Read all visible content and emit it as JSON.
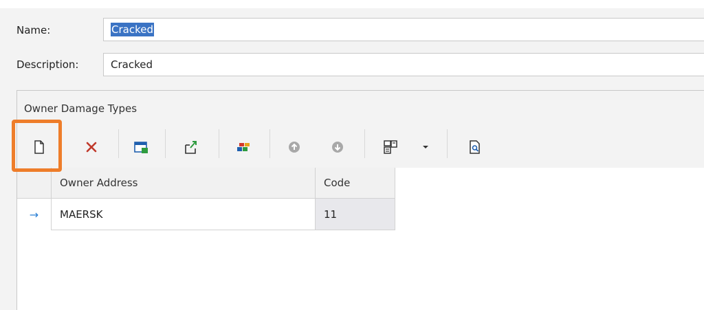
{
  "form": {
    "name_label": "Name:",
    "name_value": "Cracked",
    "description_label": "Description:",
    "description_value": "Cracked"
  },
  "panel": {
    "title": "Owner Damage Types"
  },
  "toolbar": {
    "buttons": [
      {
        "name": "new",
        "icon": "new-document-icon"
      },
      {
        "name": "delete",
        "icon": "delete-x-icon"
      },
      {
        "name": "edit-window",
        "icon": "window-icon"
      },
      {
        "name": "export",
        "icon": "export-arrow-icon"
      },
      {
        "name": "color-categories",
        "icon": "color-blocks-icon"
      },
      {
        "name": "move-up",
        "icon": "arrow-up-circle-icon"
      },
      {
        "name": "move-down",
        "icon": "arrow-down-circle-icon"
      },
      {
        "name": "column-chooser",
        "icon": "columns-icon"
      },
      {
        "name": "dropdown",
        "icon": "chevron-down-icon"
      },
      {
        "name": "preview",
        "icon": "print-preview-icon"
      }
    ],
    "colors": {
      "delete": "#c0392b",
      "green": "#2e9b3f",
      "blue": "#1f5fae",
      "red": "#d33a2c",
      "orange": "#e8a51c",
      "disabled": "#a8a8a8",
      "highlight": "#ee7d2a"
    }
  },
  "grid": {
    "columns": [
      "Owner Address",
      "Code"
    ],
    "rows": [
      {
        "indicator": "→",
        "owner_address": "MAERSK",
        "code": "11"
      }
    ]
  }
}
